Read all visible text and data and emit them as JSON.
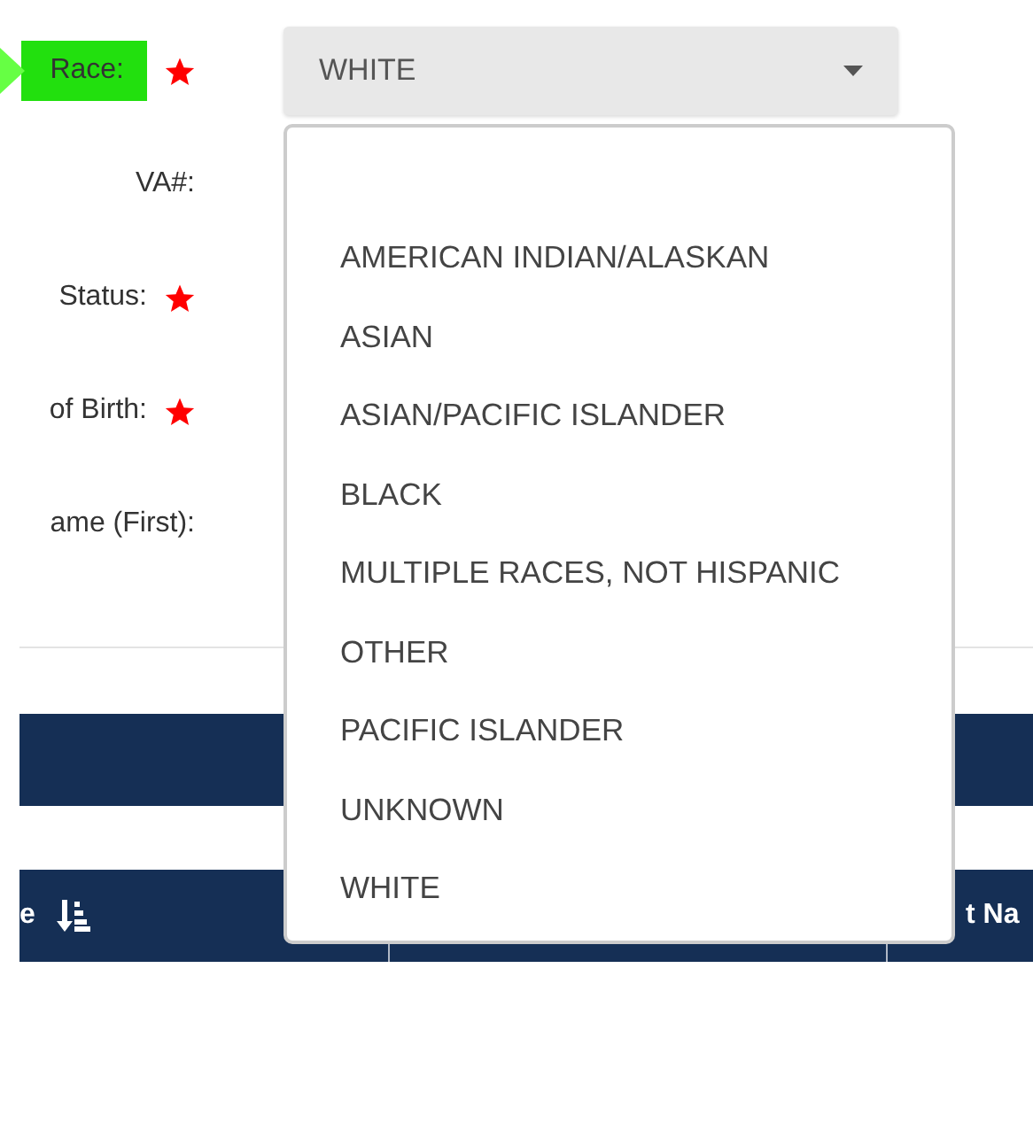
{
  "form": {
    "fields": [
      {
        "label": "Race:",
        "required": true,
        "highlighted": true,
        "kind": "select",
        "value": "WHITE"
      },
      {
        "label": "VA#:",
        "required": false,
        "highlighted": false,
        "kind": "hidden"
      },
      {
        "label": "Status:",
        "required": true,
        "highlighted": false,
        "kind": "hidden"
      },
      {
        "label": "of Birth:",
        "required": true,
        "highlighted": false,
        "kind": "hidden"
      },
      {
        "label": "ame (First):",
        "required": false,
        "highlighted": false,
        "kind": "hidden"
      }
    ]
  },
  "dropdown": {
    "options": [
      {
        "blank": true,
        "selected": false
      },
      {
        "label": "AMERICAN INDIAN/ALASKAN",
        "selected": false
      },
      {
        "label": "ASIAN",
        "selected": false
      },
      {
        "label": "ASIAN/PACIFIC ISLANDER",
        "selected": false
      },
      {
        "label": "BLACK",
        "selected": false
      },
      {
        "label": "MULTIPLE RACES, NOT HISPANIC",
        "selected": false
      },
      {
        "label": "OTHER",
        "selected": false
      },
      {
        "label": "PACIFIC ISLANDER",
        "selected": false
      },
      {
        "label": "UNKNOWN",
        "selected": false
      },
      {
        "label": "WHITE",
        "selected": false
      }
    ]
  },
  "table": {
    "columns": [
      {
        "label": "e",
        "sortable": true
      },
      {
        "sortable": false
      },
      {
        "label": "t Na",
        "sortable": false
      }
    ]
  }
}
